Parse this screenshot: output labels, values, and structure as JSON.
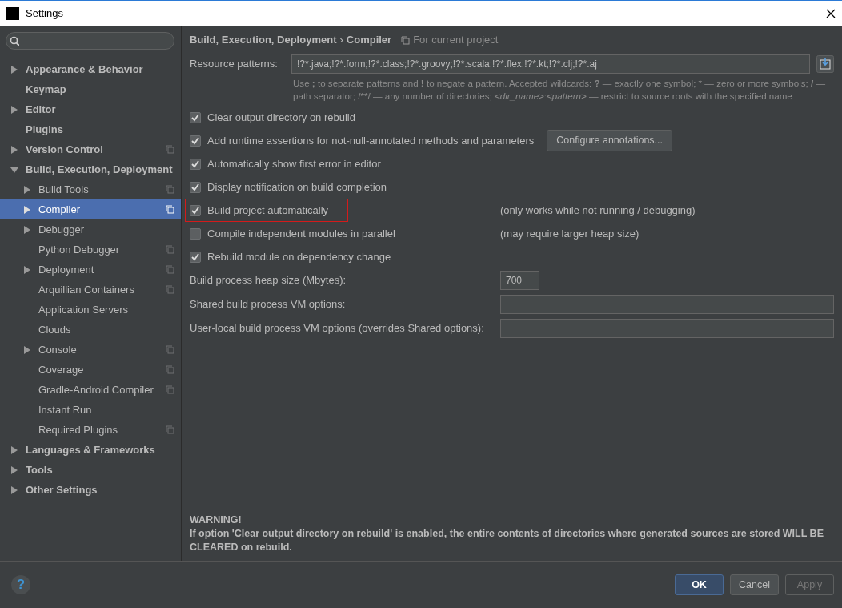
{
  "window": {
    "title": "Settings"
  },
  "sidebar": {
    "items": [
      {
        "label": "Appearance & Behavior",
        "kind": "folder",
        "expanded": false,
        "selected": false,
        "project_level": false
      },
      {
        "label": "Keymap",
        "kind": "page",
        "selected": false,
        "project_level": false
      },
      {
        "label": "Editor",
        "kind": "folder",
        "expanded": false,
        "selected": false,
        "project_level": false
      },
      {
        "label": "Plugins",
        "kind": "page",
        "selected": false,
        "project_level": false
      },
      {
        "label": "Version Control",
        "kind": "folder",
        "expanded": false,
        "selected": false,
        "project_level": true
      },
      {
        "label": "Build, Execution, Deployment",
        "kind": "folder",
        "expanded": true,
        "selected": false,
        "project_level": false,
        "children": [
          {
            "label": "Build Tools",
            "kind": "folder",
            "expanded": false,
            "selected": false,
            "project_level": true
          },
          {
            "label": "Compiler",
            "kind": "folder",
            "expanded": false,
            "selected": true,
            "project_level": true
          },
          {
            "label": "Debugger",
            "kind": "folder",
            "expanded": false,
            "selected": false,
            "project_level": false
          },
          {
            "label": "Python Debugger",
            "kind": "page",
            "selected": false,
            "project_level": true
          },
          {
            "label": "Deployment",
            "kind": "folder",
            "expanded": false,
            "selected": false,
            "project_level": true
          },
          {
            "label": "Arquillian Containers",
            "kind": "page",
            "selected": false,
            "project_level": true
          },
          {
            "label": "Application Servers",
            "kind": "page",
            "selected": false,
            "project_level": false
          },
          {
            "label": "Clouds",
            "kind": "page",
            "selected": false,
            "project_level": false
          },
          {
            "label": "Console",
            "kind": "folder",
            "expanded": false,
            "selected": false,
            "project_level": true
          },
          {
            "label": "Coverage",
            "kind": "page",
            "selected": false,
            "project_level": true
          },
          {
            "label": "Gradle-Android Compiler",
            "kind": "page",
            "selected": false,
            "project_level": true
          },
          {
            "label": "Instant Run",
            "kind": "page",
            "selected": false,
            "project_level": false
          },
          {
            "label": "Required Plugins",
            "kind": "page",
            "selected": false,
            "project_level": true
          }
        ]
      },
      {
        "label": "Languages & Frameworks",
        "kind": "folder",
        "expanded": false,
        "selected": false,
        "project_level": false
      },
      {
        "label": "Tools",
        "kind": "folder",
        "expanded": false,
        "selected": false,
        "project_level": false
      },
      {
        "label": "Other Settings",
        "kind": "folder",
        "expanded": false,
        "selected": false,
        "project_level": false
      }
    ]
  },
  "breadcrumb": {
    "parent": "Build, Execution, Deployment",
    "separator": "›",
    "current": "Compiler",
    "scope": "For current project"
  },
  "resource_patterns": {
    "label": "Resource patterns:",
    "value": "!?*.java;!?*.form;!?*.class;!?*.groovy;!?*.scala;!?*.flex;!?*.kt;!?*.clj;!?*.aj",
    "help": "Use **;** to separate patterns and **!** to negate a pattern. Accepted wildcards: **?** — exactly one symbol; * — zero or more symbols; **/** — path separator; /**/ — any number of directories; *<dir_name>*:*<pattern>* — restrict to source roots with the specified name"
  },
  "options": [
    {
      "label": "Clear output directory on rebuild",
      "checked": true,
      "highlighted": false
    },
    {
      "label": "Add runtime assertions for not-null-annotated methods and parameters",
      "checked": true,
      "highlighted": false,
      "button": "Configure annotations..."
    },
    {
      "label": "Automatically show first error in editor",
      "checked": true,
      "highlighted": false
    },
    {
      "label": "Display notification on build completion",
      "checked": true,
      "highlighted": false
    },
    {
      "label": "Build project automatically",
      "checked": true,
      "highlighted": true,
      "note": "(only works while not running / debugging)"
    },
    {
      "label": "Compile independent modules in parallel",
      "checked": false,
      "highlighted": false,
      "note": "(may require larger heap size)"
    },
    {
      "label": "Rebuild module on dependency change",
      "checked": true,
      "highlighted": false
    }
  ],
  "fields": [
    {
      "label": "Build process heap size (Mbytes):",
      "value": "700",
      "kind": "short"
    },
    {
      "label": "Shared build process VM options:",
      "kind": "wide"
    },
    {
      "label": "User-local build process VM options (overrides Shared options):",
      "kind": "wide"
    }
  ],
  "warning": {
    "title": "WARNING!",
    "text": "If option 'Clear output directory on rebuild' is enabled, the entire contents of directories where generated sources are stored WILL BE CLEARED on rebuild."
  },
  "help_button": {
    "label": "?"
  },
  "buttons": [
    {
      "label": "OK",
      "kind": "default",
      "disabled": false
    },
    {
      "label": "Cancel",
      "kind": "normal",
      "disabled": false
    },
    {
      "label": "Apply",
      "kind": "normal",
      "disabled": true
    }
  ]
}
